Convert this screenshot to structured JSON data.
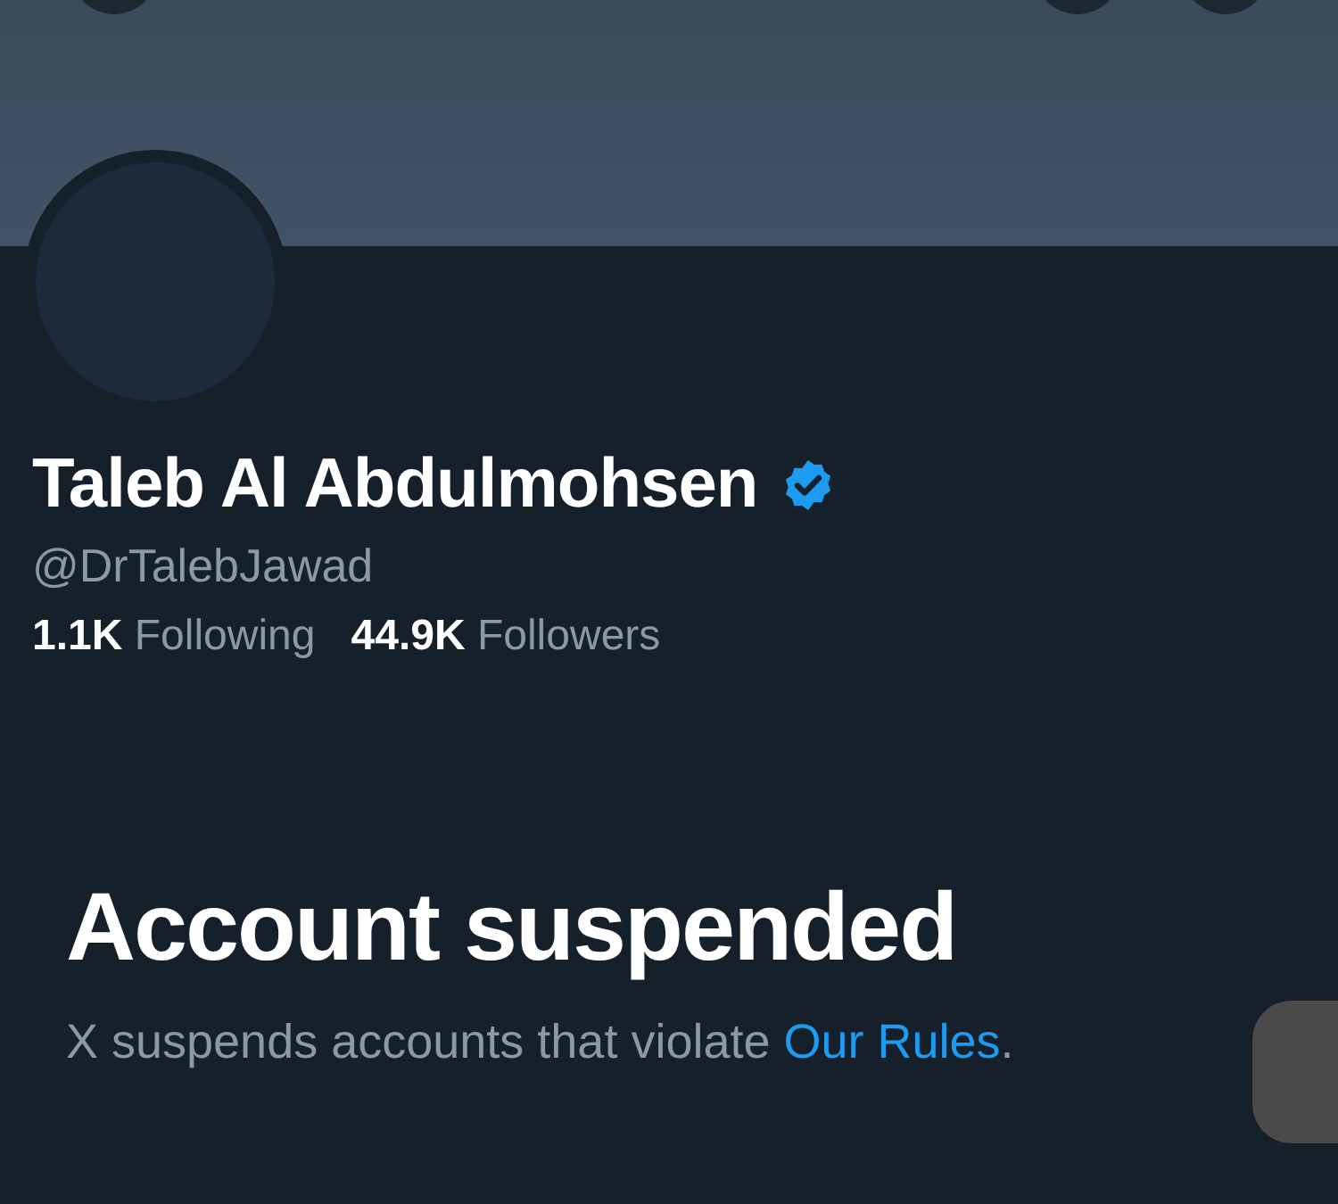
{
  "profile": {
    "name": "Taleb Al Abdulmohsen",
    "verified": true,
    "handle": "@DrTalebJawad",
    "stats": [
      "**1.1K** Following",
      "**44.9K** Followers"
    ]
  },
  "notice": {
    "title": "Account suspended",
    "text": "X suspends accounts that violate ",
    "link": "Our Rules",
    "end": "."
  }
}
